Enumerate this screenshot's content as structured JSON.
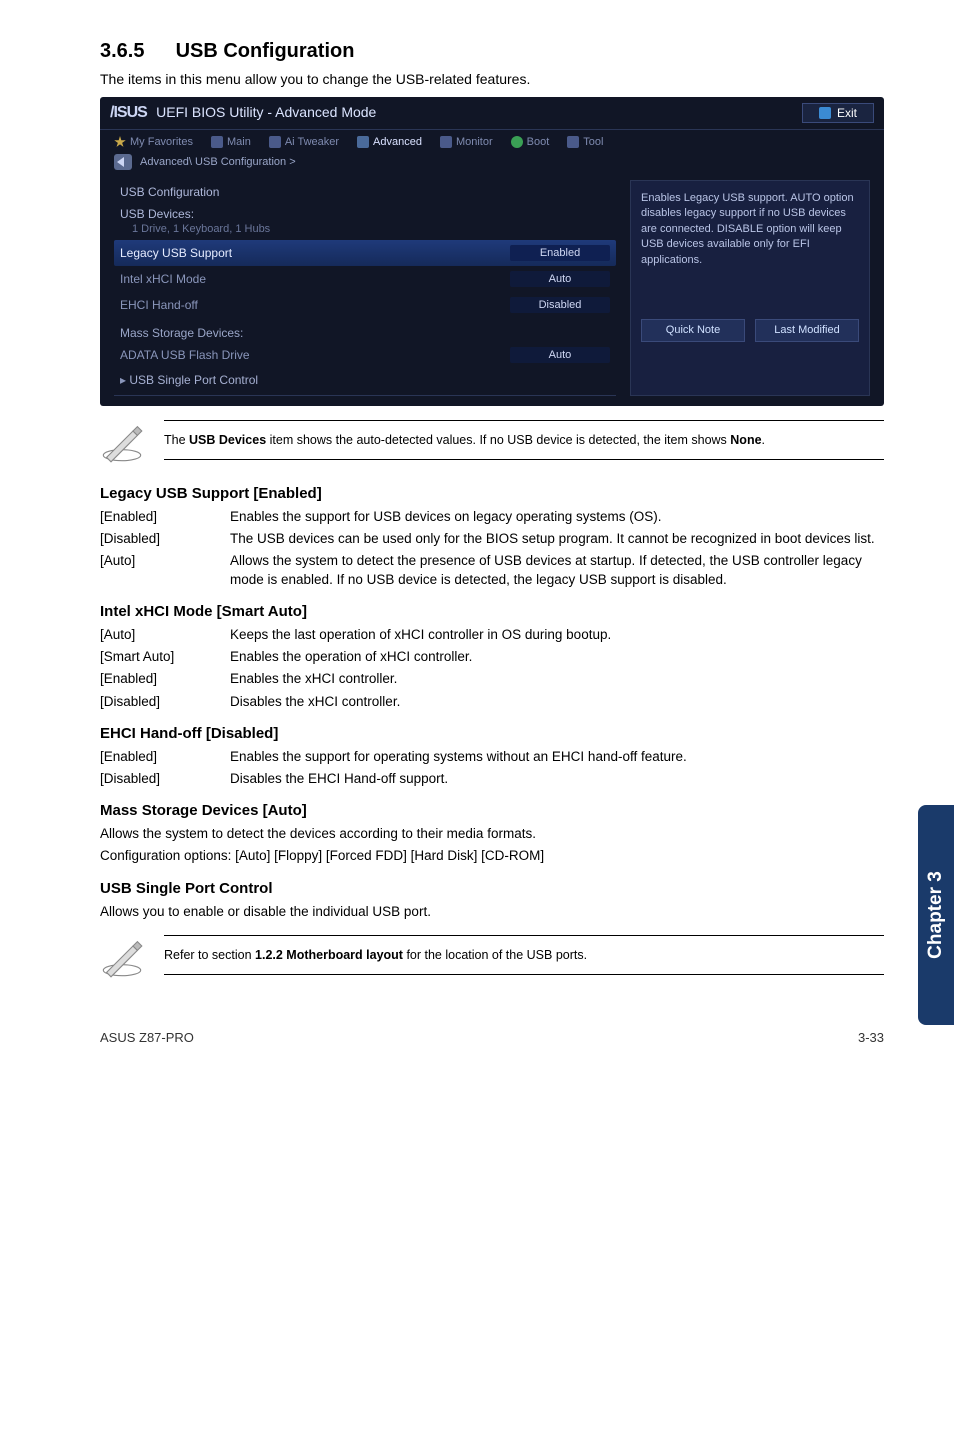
{
  "section": {
    "number": "3.6.5",
    "title": "USB Configuration"
  },
  "intro": "The items in this menu allow you to change the USB-related features.",
  "bios": {
    "logo": "/ISUS",
    "title": "UEFI BIOS Utility - Advanced Mode",
    "exit": "Exit",
    "tabs": {
      "fav": "My Favorites",
      "main": "Main",
      "tweaker": "Ai Tweaker",
      "advanced": "Advanced",
      "monitor": "Monitor",
      "boot": "Boot",
      "tool": "Tool"
    },
    "breadcrumb": "Advanced\\ USB Configuration >",
    "header_row": "USB Configuration",
    "devices_row": "USB Devices:",
    "devices_detail": "1 Drive, 1 Keyboard, 1 Hubs",
    "rows": [
      {
        "label": "Legacy USB Support",
        "value": "Enabled",
        "hl": true
      },
      {
        "label": "Intel xHCI Mode",
        "value": "Auto"
      },
      {
        "label": "EHCI Hand-off",
        "value": "Disabled"
      }
    ],
    "mass_header": "Mass Storage Devices:",
    "mass_item": {
      "label": "ADATA USB Flash Drive",
      "value": "Auto"
    },
    "tree_item": "USB Single Port Control",
    "help": "Enables Legacy USB support. AUTO option disables legacy support if no USB devices are connected. DISABLE option will keep USB devices available only for EFI applications.",
    "quick_note": "Quick Note",
    "last_mod": "Last Modified"
  },
  "note1": "The USB Devices item shows the auto-detected values. If no USB device is detected, the item shows None.",
  "note1_bold1": "USB Devices",
  "note1_bold2": "None",
  "legacy": {
    "head": "Legacy USB Support [Enabled]",
    "rows": [
      {
        "key": "[Enabled]",
        "desc": "Enables the support for USB devices on legacy operating systems (OS)."
      },
      {
        "key": "[Disabled]",
        "desc": "The USB devices can be used only for the BIOS setup program. It cannot be recognized in boot devices list."
      },
      {
        "key": "[Auto]",
        "desc": "Allows the system to detect the presence of USB devices at startup. If detected, the USB controller legacy mode is enabled. If no USB device is detected, the legacy USB support is disabled."
      }
    ]
  },
  "xhci": {
    "head": "Intel xHCI Mode [Smart Auto]",
    "rows": [
      {
        "key": "[Auto]",
        "desc": "Keeps the last operation of xHCI controller in OS during bootup."
      },
      {
        "key": "[Smart Auto]",
        "desc": "Enables the operation of xHCI controller."
      },
      {
        "key": "[Enabled]",
        "desc": "Enables the xHCI controller."
      },
      {
        "key": "[Disabled]",
        "desc": "Disables the xHCI controller."
      }
    ]
  },
  "ehci": {
    "head": "EHCI Hand-off [Disabled]",
    "rows": [
      {
        "key": "[Enabled]",
        "desc": "Enables the support for operating systems without an EHCI hand-off feature."
      },
      {
        "key": "[Disabled]",
        "desc": "Disables the EHCI Hand-off support."
      }
    ]
  },
  "mass": {
    "head": "Mass Storage Devices [Auto]",
    "line1": "Allows the system to detect the devices according to their media formats.",
    "line2": "Configuration options: [Auto] [Floppy] [Forced FDD] [Hard Disk] [CD-ROM]"
  },
  "single": {
    "head": "USB Single Port Control",
    "line1": "Allows you to enable or disable the individual USB port."
  },
  "note2": "Refer to section 1.2.2 Motherboard layout for the location of the USB ports.",
  "note2_bold": "1.2.2 Motherboard layout",
  "side_tab": "Chapter 3",
  "footer": {
    "left": "ASUS Z87-PRO",
    "right": "3-33"
  }
}
